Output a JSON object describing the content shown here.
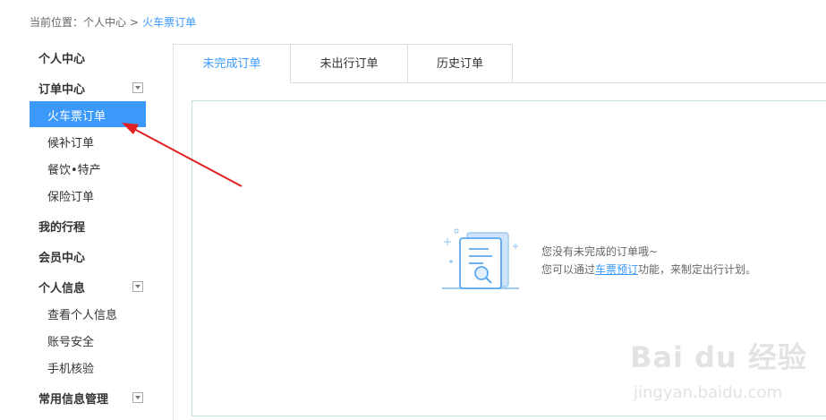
{
  "breadcrumb": {
    "prefix": "当前位置：",
    "home": "个人中心",
    "sep": ">",
    "current": "火车票订单"
  },
  "sidebar": {
    "personal_center": "个人中心",
    "order_center": "订单中心",
    "train_orders": "火车票订单",
    "waitlist_orders": "候补订单",
    "dining_specialty": "餐饮•特产",
    "insurance_orders": "保险订单",
    "my_trips": "我的行程",
    "member_center": "会员中心",
    "personal_info": "个人信息",
    "view_personal_info": "查看个人信息",
    "account_security": "账号安全",
    "phone_verify": "手机核验",
    "common_info_mgmt": "常用信息管理"
  },
  "tabs": [
    {
      "label": "未完成订单",
      "active": true
    },
    {
      "label": "未出行订单",
      "active": false
    },
    {
      "label": "历史订单",
      "active": false
    }
  ],
  "empty_state": {
    "line1": "您没有未完成的订单哦~",
    "line2_prefix": "您可以通过",
    "link": "车票预订",
    "line2_suffix": "功能，来制定出行计划。",
    "icon": "document-search-icon"
  },
  "watermark": {
    "main": "Bai du 经验",
    "sub": "jingyan.baidu.com"
  },
  "colors": {
    "accent": "#3b99fc",
    "annotation_arrow": "#e02020"
  }
}
